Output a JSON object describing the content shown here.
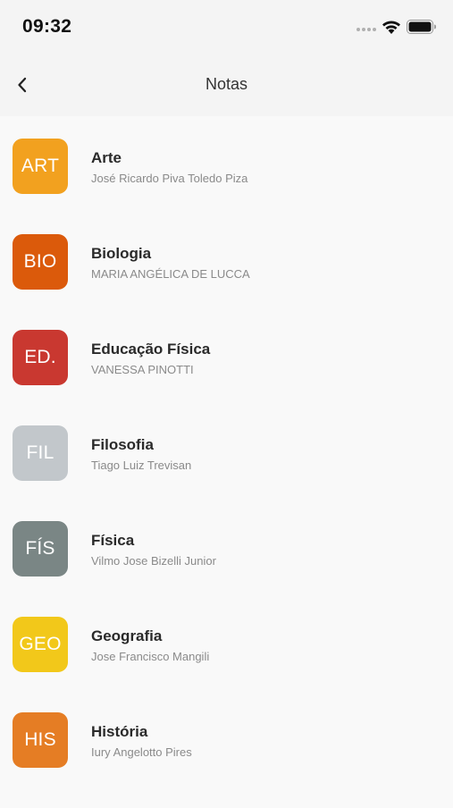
{
  "status_bar": {
    "time": "09:32"
  },
  "nav": {
    "title": "Notas"
  },
  "subjects": [
    {
      "abbr": "ART",
      "name": "Arte",
      "teacher": "José Ricardo Piva Toledo Piza",
      "color": "#f2a11f"
    },
    {
      "abbr": "BIO",
      "name": "Biologia",
      "teacher": "MARIA ANGÉLICA DE LUCCA",
      "color": "#db5a0b"
    },
    {
      "abbr": "ED.",
      "name": "Educação Física",
      "teacher": "VANESSA PINOTTI",
      "color": "#c93830"
    },
    {
      "abbr": "FIL",
      "name": "Filosofia",
      "teacher": "Tiago Luiz Trevisan",
      "color": "#c2c7cb"
    },
    {
      "abbr": "FÍS",
      "name": "Física",
      "teacher": "Vilmo Jose Bizelli Junior",
      "color": "#7a8685"
    },
    {
      "abbr": "GEO",
      "name": "Geografia",
      "teacher": "Jose Francisco Mangili",
      "color": "#f2c81a"
    },
    {
      "abbr": "HIS",
      "name": "História",
      "teacher": "Iury Angelotto Pires",
      "color": "#e57d24"
    }
  ],
  "icons": {
    "back": "chevron-left-icon",
    "wifi": "wifi-icon",
    "battery": "battery-icon",
    "signal": "cellular-signal-icon"
  }
}
